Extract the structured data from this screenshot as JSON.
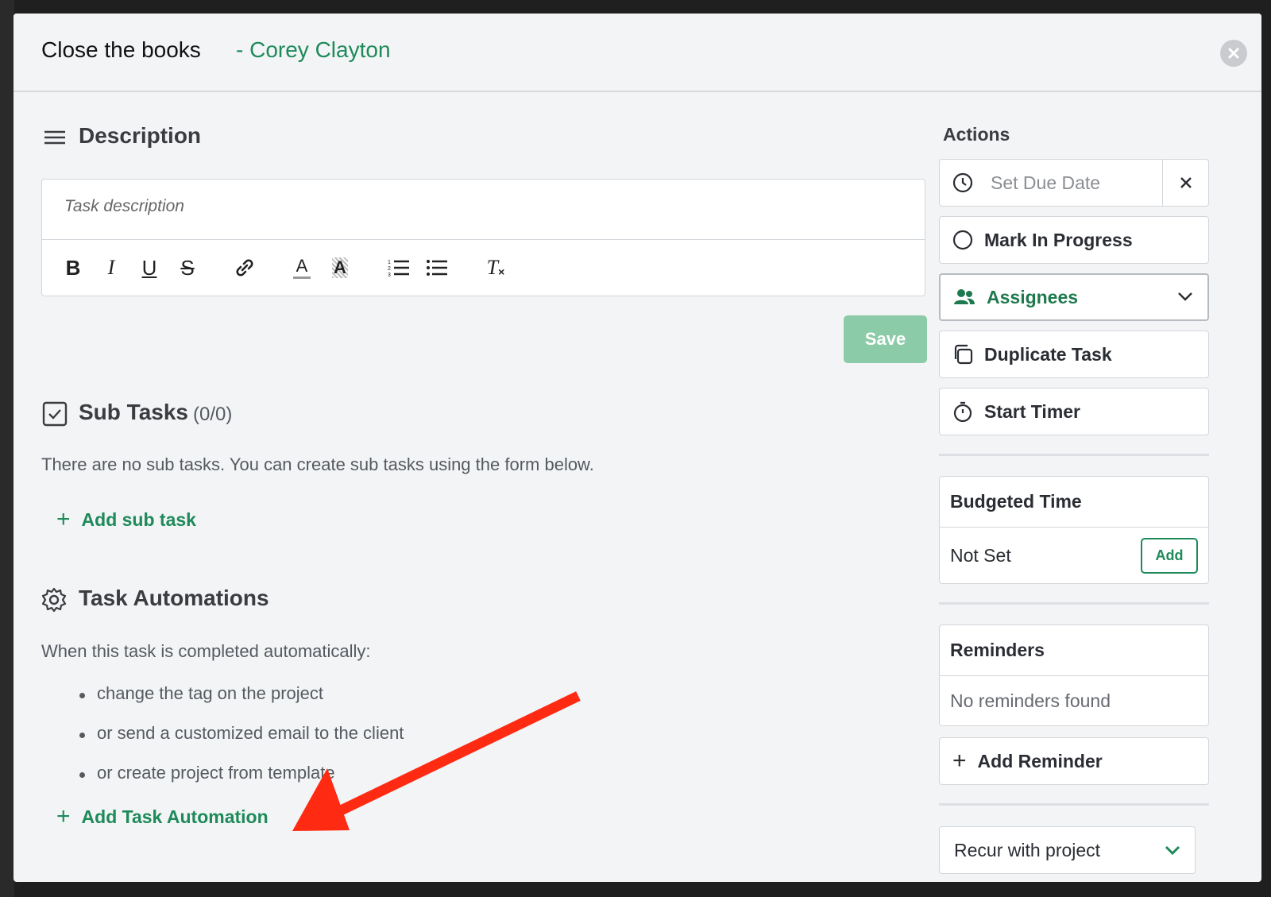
{
  "modal": {
    "title": "Close the books",
    "client": "- Corey Clayton"
  },
  "description": {
    "heading": "Description",
    "placeholder": "Task description",
    "toolbar": [
      {
        "name": "bold-icon",
        "glyph": "B"
      },
      {
        "name": "italic-icon",
        "glyph": "I"
      },
      {
        "name": "underline-icon",
        "glyph": "U"
      },
      {
        "name": "strikethrough-icon",
        "glyph": "S"
      },
      {
        "name": "link-icon",
        "glyph": "link"
      },
      {
        "name": "text-color-icon",
        "glyph": "A"
      },
      {
        "name": "highlight-color-icon",
        "glyph": "A"
      },
      {
        "name": "ordered-list-icon",
        "glyph": "ol"
      },
      {
        "name": "bullet-list-icon",
        "glyph": "ul"
      },
      {
        "name": "clear-format-icon",
        "glyph": "Tx"
      }
    ],
    "save_label": "Save"
  },
  "subtasks": {
    "heading": "Sub Tasks",
    "count": "(0/0)",
    "empty_text": "There are no sub tasks. You can create sub tasks using the form below.",
    "add_label": "Add sub task"
  },
  "automations": {
    "heading": "Task Automations",
    "intro": "When this task is completed automatically:",
    "items": [
      "change the tag on the project",
      "or send a customized email to the client",
      "or create project from template"
    ],
    "add_label": "Add Task Automation"
  },
  "actions": {
    "heading": "Actions",
    "due_date_placeholder": "Set Due Date",
    "mark_in_progress": "Mark In Progress",
    "assignees": "Assignees",
    "duplicate": "Duplicate Task",
    "start_timer": "Start Timer"
  },
  "budgeted_time": {
    "heading": "Budgeted Time",
    "value": "Not Set",
    "add_label": "Add"
  },
  "reminders": {
    "heading": "Reminders",
    "empty_text": "No reminders found",
    "add_label": "Add Reminder"
  },
  "recur": {
    "selected": "Recur with project"
  },
  "colors": {
    "accent": "#1e8a5a",
    "save_disabled": "#8ccba7",
    "annotation_arrow": "#ff2a12"
  }
}
